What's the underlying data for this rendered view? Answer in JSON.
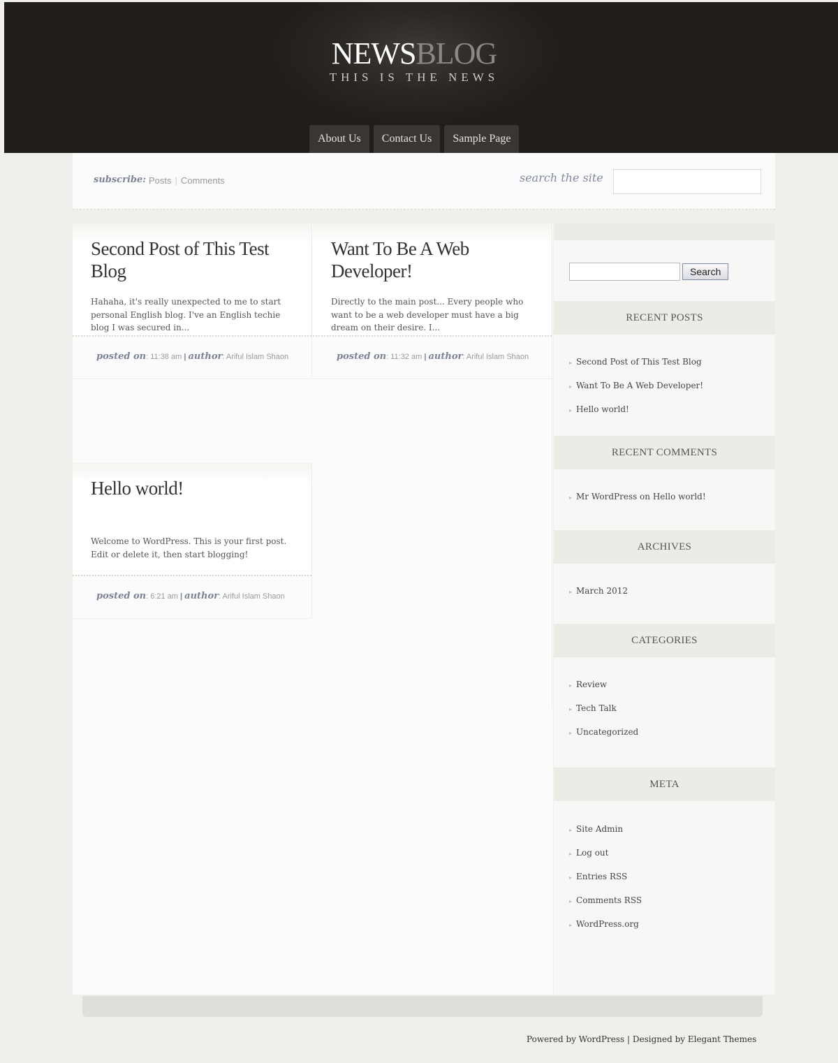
{
  "header": {
    "logo_news": "NEWS",
    "logo_blog": "BLOG",
    "tagline": "THIS IS THE NEWS",
    "nav": [
      "About Us",
      "Contact Us",
      "Sample Page"
    ]
  },
  "subbar": {
    "subscribe_label": "subscribe:",
    "posts_link": "Posts",
    "separator": "|",
    "comments_link": "Comments",
    "search_label": "search the site",
    "search_placeholder": ""
  },
  "posts": [
    {
      "title": "Second Post of This Test Blog",
      "excerpt": "Hahaha, it's really unexpected to me to start personal English blog. I've an English techie blog I was secured in...",
      "posted_label": "posted on",
      "time": "11:38 am",
      "author_label": "author",
      "author": "Ariful Islam Shaon"
    },
    {
      "title": "Want To Be A Web Developer!",
      "excerpt": "Directly to the main post... Every people who want to be a web developer must have a big dream on their desire. I...",
      "posted_label": "posted on",
      "time": "11:32 am",
      "author_label": "author",
      "author": "Ariful Islam Shaon"
    },
    {
      "title": "Hello world!",
      "excerpt": "Welcome to WordPress. This is your first post. Edit or delete it, then start blogging!",
      "posted_label": "posted on",
      "time": "6:21 am",
      "author_label": "author",
      "author": "Ariful Islam Shaon"
    }
  ],
  "sidebar": {
    "search_button": "Search",
    "recent_posts_title": "RECENT POSTS",
    "recent_posts": [
      "Second Post of This Test Blog",
      "Want To Be A Web Developer!",
      "Hello world!"
    ],
    "recent_comments_title": "RECENT COMMENTS",
    "recent_comments": [
      "Mr WordPress on Hello world!"
    ],
    "archives_title": "ARCHIVES",
    "archives": [
      "March 2012"
    ],
    "categories_title": "CATEGORIES",
    "categories": [
      "Review",
      "Tech Talk",
      "Uncategorized"
    ],
    "meta_title": "META",
    "meta": [
      "Site Admin",
      "Log out",
      "Entries RSS",
      "Comments RSS",
      "WordPress.org"
    ]
  },
  "footer": {
    "credits": "Powered by WordPress | Designed by Elegant Themes"
  }
}
